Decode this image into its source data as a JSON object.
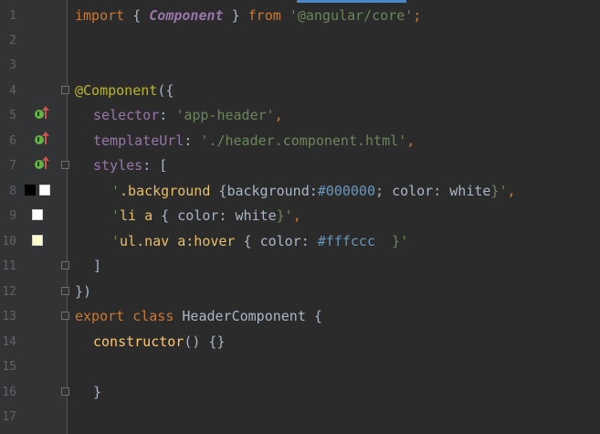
{
  "editor": {
    "line_numbers": [
      "1",
      "2",
      "3",
      "4",
      "5",
      "6",
      "7",
      "8",
      "9",
      "10",
      "11",
      "12",
      "13",
      "14",
      "15",
      "16",
      "17"
    ],
    "lines": {
      "l1": {
        "import": "import",
        "brace_open": " { ",
        "component": "Component",
        "brace_close": " } ",
        "from": "from",
        "space": " ",
        "module": "'@angular/core'",
        "semi": ";"
      },
      "l4": {
        "decorator": "@Component",
        "paren": "({"
      },
      "l5": {
        "key": "selector",
        "colon": ": ",
        "value": "'app-header'",
        "comma": ","
      },
      "l6": {
        "key": "templateUrl",
        "colon": ": ",
        "value": "'./header.component.html'",
        "comma": ","
      },
      "l7": {
        "key": "styles",
        "colon": ": ",
        "bracket": "["
      },
      "l8": {
        "q1": "'",
        "selector": ".background",
        "open": " {",
        "prop": "background:",
        "val": "#000000",
        "semi": "; ",
        "prop2": "color: ",
        "kw": "white",
        "close": "}'",
        "comma": ","
      },
      "l9": {
        "q1": "'",
        "selector": "li a",
        "open": " { ",
        "prop": "color: ",
        "kw": "white",
        "close": "}'",
        "comma": ","
      },
      "l10": {
        "q1": "'",
        "selector": "ul.nav a:hover",
        "open": " { ",
        "prop": "color: ",
        "val": "#fffccc",
        "close": "  }'"
      },
      "l11": {
        "bracket": "]"
      },
      "l12": {
        "text": "})"
      },
      "l13": {
        "export": "export",
        "sp1": " ",
        "class": "class",
        "sp2": " ",
        "name": "HeaderComponent",
        "open": " {"
      },
      "l14": {
        "method": "constructor",
        "rest": "() {}"
      },
      "l16": {
        "brace": "}"
      }
    }
  },
  "colors": {
    "swatch_black": "#000000",
    "swatch_white": "#ffffff",
    "swatch_cream": "#fffccc"
  }
}
